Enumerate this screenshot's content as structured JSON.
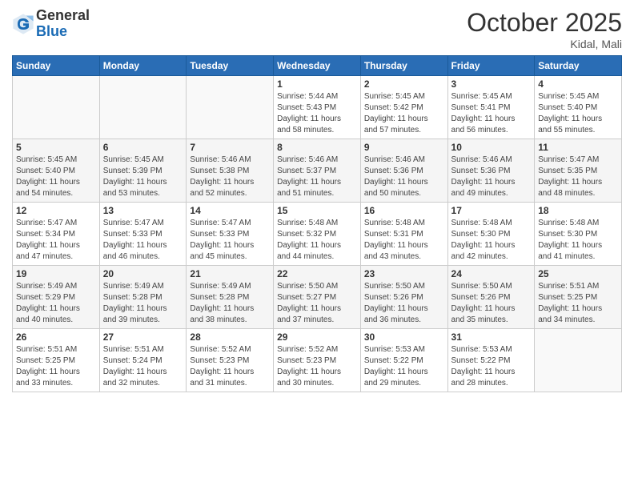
{
  "header": {
    "logo_general": "General",
    "logo_blue": "Blue",
    "month_title": "October 2025",
    "location": "Kidal, Mali"
  },
  "days_of_week": [
    "Sunday",
    "Monday",
    "Tuesday",
    "Wednesday",
    "Thursday",
    "Friday",
    "Saturday"
  ],
  "weeks": [
    [
      {
        "day": "",
        "info": ""
      },
      {
        "day": "",
        "info": ""
      },
      {
        "day": "",
        "info": ""
      },
      {
        "day": "1",
        "info": "Sunrise: 5:44 AM\nSunset: 5:43 PM\nDaylight: 11 hours\nand 58 minutes."
      },
      {
        "day": "2",
        "info": "Sunrise: 5:45 AM\nSunset: 5:42 PM\nDaylight: 11 hours\nand 57 minutes."
      },
      {
        "day": "3",
        "info": "Sunrise: 5:45 AM\nSunset: 5:41 PM\nDaylight: 11 hours\nand 56 minutes."
      },
      {
        "day": "4",
        "info": "Sunrise: 5:45 AM\nSunset: 5:40 PM\nDaylight: 11 hours\nand 55 minutes."
      }
    ],
    [
      {
        "day": "5",
        "info": "Sunrise: 5:45 AM\nSunset: 5:40 PM\nDaylight: 11 hours\nand 54 minutes."
      },
      {
        "day": "6",
        "info": "Sunrise: 5:45 AM\nSunset: 5:39 PM\nDaylight: 11 hours\nand 53 minutes."
      },
      {
        "day": "7",
        "info": "Sunrise: 5:46 AM\nSunset: 5:38 PM\nDaylight: 11 hours\nand 52 minutes."
      },
      {
        "day": "8",
        "info": "Sunrise: 5:46 AM\nSunset: 5:37 PM\nDaylight: 11 hours\nand 51 minutes."
      },
      {
        "day": "9",
        "info": "Sunrise: 5:46 AM\nSunset: 5:36 PM\nDaylight: 11 hours\nand 50 minutes."
      },
      {
        "day": "10",
        "info": "Sunrise: 5:46 AM\nSunset: 5:36 PM\nDaylight: 11 hours\nand 49 minutes."
      },
      {
        "day": "11",
        "info": "Sunrise: 5:47 AM\nSunset: 5:35 PM\nDaylight: 11 hours\nand 48 minutes."
      }
    ],
    [
      {
        "day": "12",
        "info": "Sunrise: 5:47 AM\nSunset: 5:34 PM\nDaylight: 11 hours\nand 47 minutes."
      },
      {
        "day": "13",
        "info": "Sunrise: 5:47 AM\nSunset: 5:33 PM\nDaylight: 11 hours\nand 46 minutes."
      },
      {
        "day": "14",
        "info": "Sunrise: 5:47 AM\nSunset: 5:33 PM\nDaylight: 11 hours\nand 45 minutes."
      },
      {
        "day": "15",
        "info": "Sunrise: 5:48 AM\nSunset: 5:32 PM\nDaylight: 11 hours\nand 44 minutes."
      },
      {
        "day": "16",
        "info": "Sunrise: 5:48 AM\nSunset: 5:31 PM\nDaylight: 11 hours\nand 43 minutes."
      },
      {
        "day": "17",
        "info": "Sunrise: 5:48 AM\nSunset: 5:30 PM\nDaylight: 11 hours\nand 42 minutes."
      },
      {
        "day": "18",
        "info": "Sunrise: 5:48 AM\nSunset: 5:30 PM\nDaylight: 11 hours\nand 41 minutes."
      }
    ],
    [
      {
        "day": "19",
        "info": "Sunrise: 5:49 AM\nSunset: 5:29 PM\nDaylight: 11 hours\nand 40 minutes."
      },
      {
        "day": "20",
        "info": "Sunrise: 5:49 AM\nSunset: 5:28 PM\nDaylight: 11 hours\nand 39 minutes."
      },
      {
        "day": "21",
        "info": "Sunrise: 5:49 AM\nSunset: 5:28 PM\nDaylight: 11 hours\nand 38 minutes."
      },
      {
        "day": "22",
        "info": "Sunrise: 5:50 AM\nSunset: 5:27 PM\nDaylight: 11 hours\nand 37 minutes."
      },
      {
        "day": "23",
        "info": "Sunrise: 5:50 AM\nSunset: 5:26 PM\nDaylight: 11 hours\nand 36 minutes."
      },
      {
        "day": "24",
        "info": "Sunrise: 5:50 AM\nSunset: 5:26 PM\nDaylight: 11 hours\nand 35 minutes."
      },
      {
        "day": "25",
        "info": "Sunrise: 5:51 AM\nSunset: 5:25 PM\nDaylight: 11 hours\nand 34 minutes."
      }
    ],
    [
      {
        "day": "26",
        "info": "Sunrise: 5:51 AM\nSunset: 5:25 PM\nDaylight: 11 hours\nand 33 minutes."
      },
      {
        "day": "27",
        "info": "Sunrise: 5:51 AM\nSunset: 5:24 PM\nDaylight: 11 hours\nand 32 minutes."
      },
      {
        "day": "28",
        "info": "Sunrise: 5:52 AM\nSunset: 5:23 PM\nDaylight: 11 hours\nand 31 minutes."
      },
      {
        "day": "29",
        "info": "Sunrise: 5:52 AM\nSunset: 5:23 PM\nDaylight: 11 hours\nand 30 minutes."
      },
      {
        "day": "30",
        "info": "Sunrise: 5:53 AM\nSunset: 5:22 PM\nDaylight: 11 hours\nand 29 minutes."
      },
      {
        "day": "31",
        "info": "Sunrise: 5:53 AM\nSunset: 5:22 PM\nDaylight: 11 hours\nand 28 minutes."
      },
      {
        "day": "",
        "info": ""
      }
    ]
  ]
}
